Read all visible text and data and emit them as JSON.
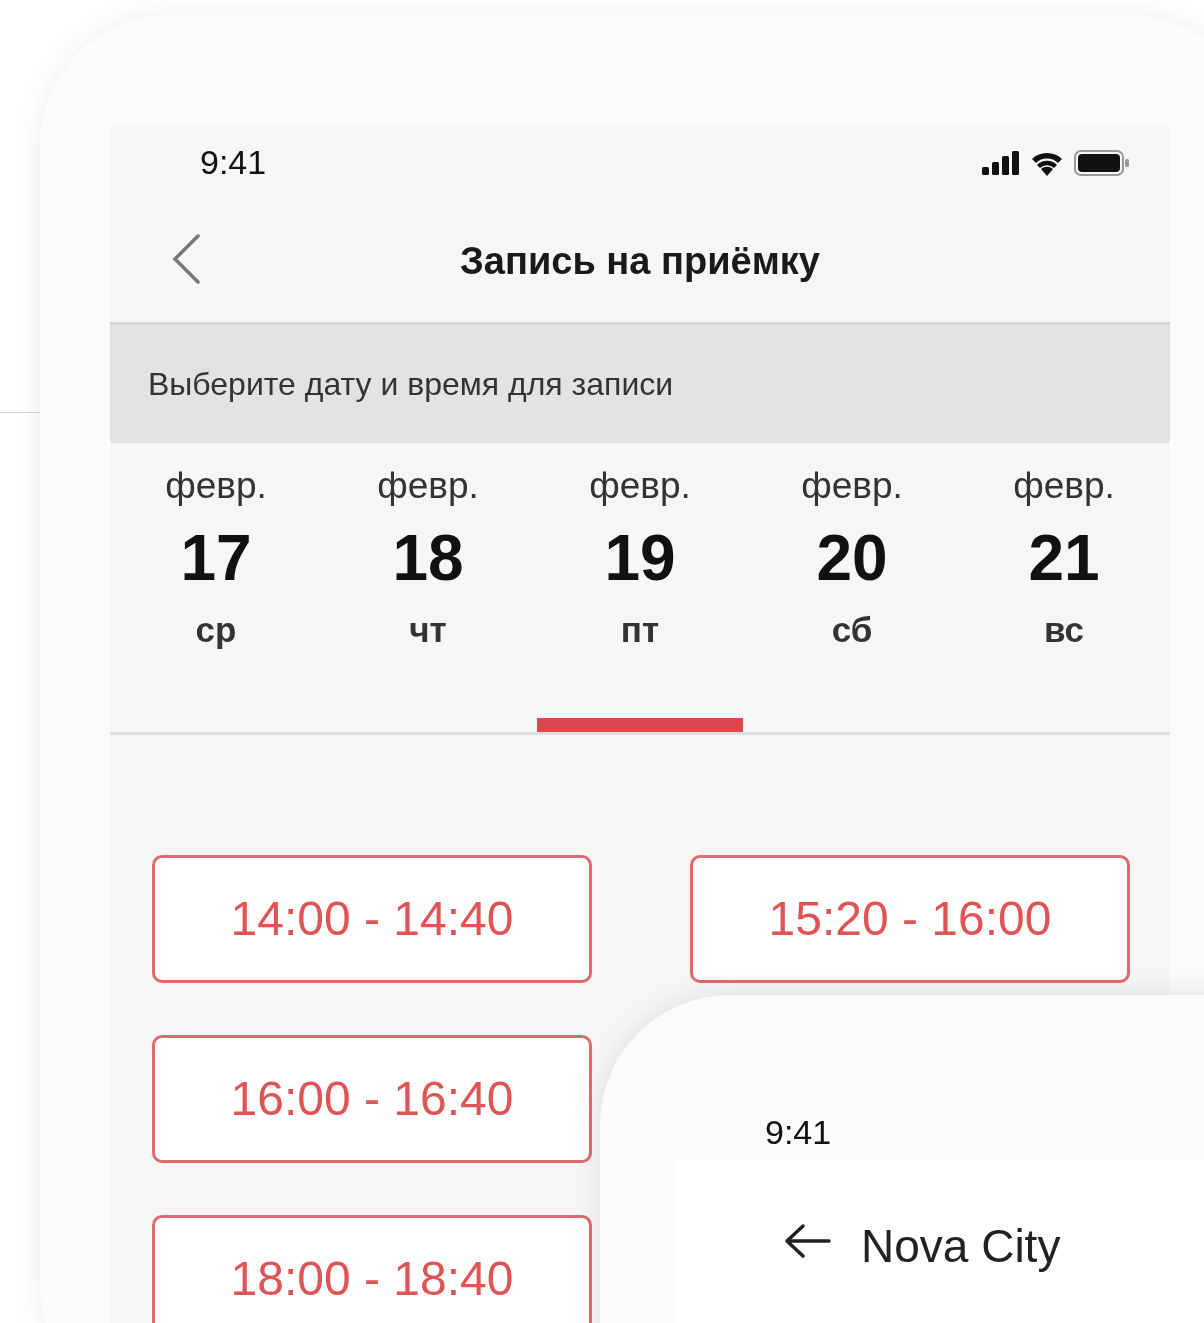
{
  "status_bar": {
    "time": "9:41"
  },
  "header": {
    "title": "Запись на приёмку"
  },
  "banner": "Выберите дату и время для записи",
  "dates": [
    {
      "month": "февр.",
      "day": "17",
      "weekday": "ср",
      "selected": false
    },
    {
      "month": "февр.",
      "day": "18",
      "weekday": "чт",
      "selected": false
    },
    {
      "month": "февр.",
      "day": "19",
      "weekday": "пт",
      "selected": true
    },
    {
      "month": "февр.",
      "day": "20",
      "weekday": "сб",
      "selected": false
    },
    {
      "month": "февр.",
      "day": "21",
      "weekday": "вс",
      "selected": false
    }
  ],
  "slot_columns": [
    [
      "14:00 - 14:40",
      "16:00 - 16:40",
      "18:00 - 18:40"
    ],
    [
      "15:20 - 16:00"
    ]
  ],
  "second_screen": {
    "status_bar": {
      "time": "9:41"
    },
    "header": {
      "title": "Nova City"
    }
  }
}
